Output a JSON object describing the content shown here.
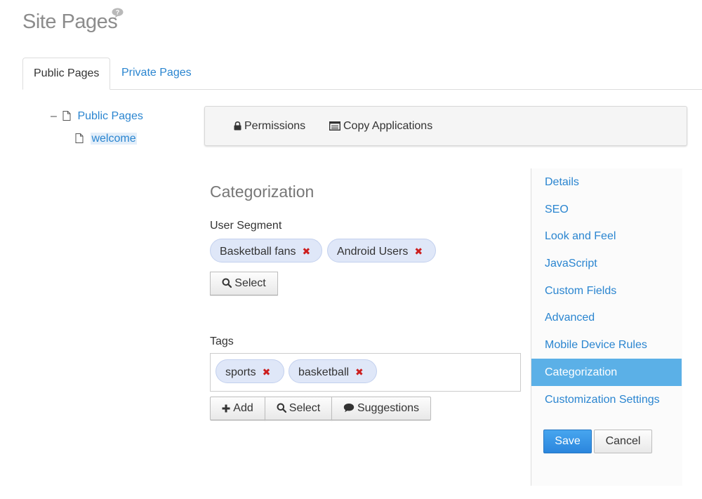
{
  "header": {
    "title": "Site Pages",
    "help_icon": "question-bubble-icon"
  },
  "tabs": [
    {
      "label": "Public Pages",
      "active": true
    },
    {
      "label": "Private Pages",
      "active": false
    }
  ],
  "tree": {
    "root_label": "Public Pages",
    "child_label": "welcome",
    "collapse_glyph": "–"
  },
  "toolbar": {
    "permissions_label": "Permissions",
    "copy_applications_label": "Copy Applications"
  },
  "form": {
    "section_title": "Categorization",
    "user_segment": {
      "label": "User Segment",
      "chips": [
        "Basketball fans",
        "Android Users"
      ],
      "select_label": "Select"
    },
    "tags": {
      "label": "Tags",
      "chips": [
        "sports",
        "basketball"
      ],
      "add_label": "Add",
      "select_label": "Select",
      "suggestions_label": "Suggestions"
    },
    "remove_glyph": "✖"
  },
  "side_nav": {
    "items": [
      "Details",
      "SEO",
      "Look and Feel",
      "JavaScript",
      "Custom Fields",
      "Advanced",
      "Mobile Device Rules",
      "Categorization",
      "Customization Settings"
    ],
    "active": "Categorization",
    "save_label": "Save",
    "cancel_label": "Cancel"
  },
  "colors": {
    "link": "#2a85d0",
    "active_nav": "#5bb0e7",
    "save_button": "#2b86dd",
    "chip": "#dfe7f8",
    "remove_x": "#cc1f1f"
  }
}
